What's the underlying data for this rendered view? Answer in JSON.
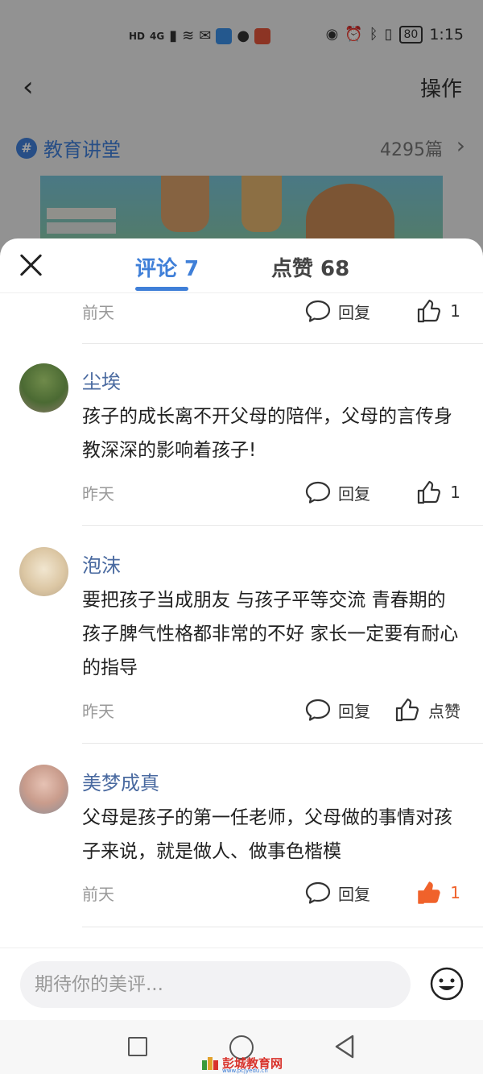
{
  "status_bar": {
    "network_label": "4G",
    "hd_label": "HD",
    "battery": "80",
    "time": "1:15"
  },
  "header": {
    "back_icon": "back-chevron-icon",
    "action_label": "操作"
  },
  "topic": {
    "badge": "#",
    "name": "教育讲堂",
    "count": "4295篇"
  },
  "sheet": {
    "tabs": [
      {
        "label": "评论 7",
        "active": true
      },
      {
        "label": "点赞 68",
        "active": false
      }
    ]
  },
  "labels": {
    "reply": "回复",
    "like": "点赞"
  },
  "top_partial": {
    "time": "前天",
    "likes": "1"
  },
  "comments": [
    {
      "user": "尘埃",
      "text": "孩子的成长离不开父母的陪伴，父母的言传身教深深的影响着孩子!",
      "time": "昨天",
      "likes": "1",
      "liked": false
    },
    {
      "user": "泡沫",
      "text": "要把孩子当成朋友  与孩子平等交流  青春期的孩子脾气性格都非常的不好  家长一定要有耐心的指导",
      "time": "昨天",
      "likes": "点赞",
      "liked": false
    },
    {
      "user": "美梦成真",
      "text": "父母是孩子的第一任老师，父母做的事情对孩子来说，就是做人、做事色楷模",
      "time": "前天",
      "likes": "1",
      "liked": true
    }
  ],
  "input": {
    "placeholder": "期待你的美评..."
  },
  "watermark": {
    "text": "彭城教育网",
    "sub": "www.pcjyedu.cn"
  },
  "colors": {
    "accent": "#3f7fd8",
    "username": "#4a6aa0",
    "liked": "#f0622b"
  }
}
